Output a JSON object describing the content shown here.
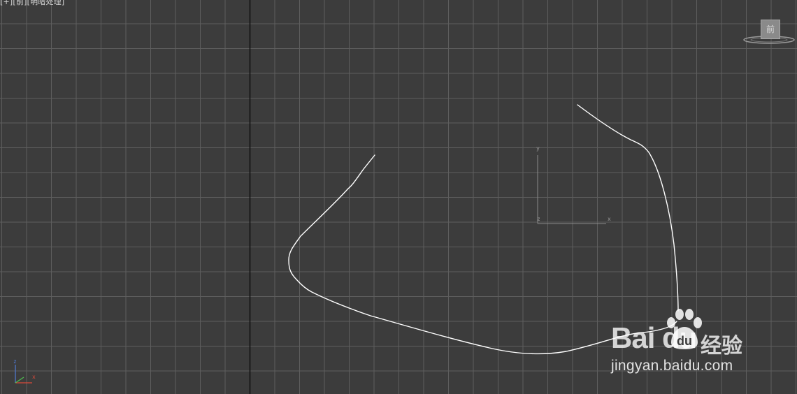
{
  "viewport": {
    "label": "[+][前][明暗处理]",
    "viewcube_face": "前",
    "pivot_axis_labels": {
      "y": "y",
      "x": "x",
      "z": "z"
    },
    "corner_axis_labels": {
      "z": "z",
      "x": "x"
    }
  },
  "watermark": {
    "brand": "Bai  du",
    "cn": "经验",
    "url": "jingyan.baidu.com"
  },
  "colors": {
    "background": "#3c3c3c",
    "grid_line": "#5e5e5e",
    "world_axis": "#111111",
    "spline": "#ffffff",
    "pivot_axis": "#8a8a8a",
    "corner_z": "#4f7bd6",
    "corner_x": "#d94a3a",
    "corner_y": "#4fbf4f"
  },
  "icons": [
    "viewcube-icon",
    "home-ring-icon",
    "baidu-paw-icon",
    "axis-tripod-icon"
  ]
}
